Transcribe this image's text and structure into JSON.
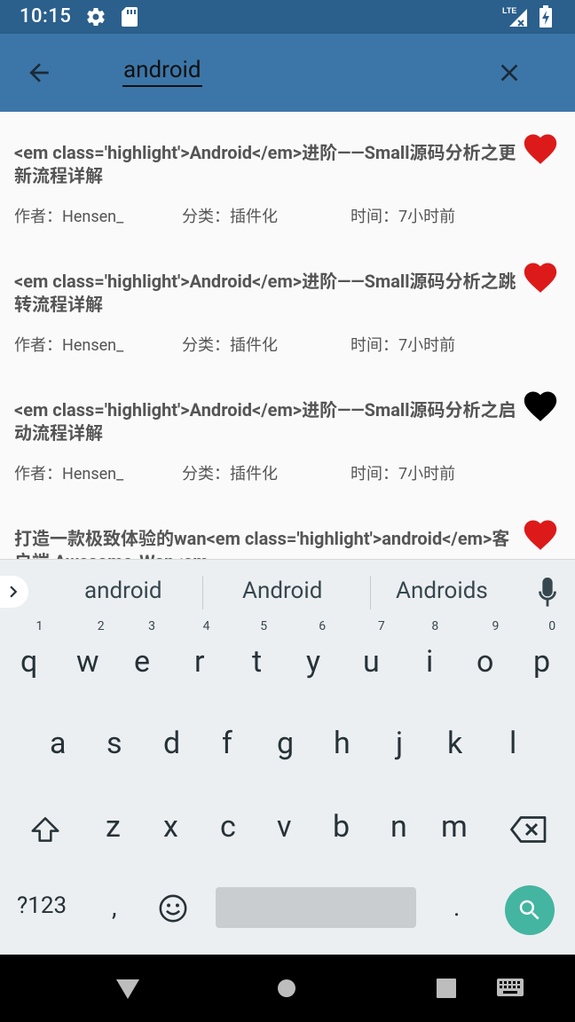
{
  "status_bar": {
    "time": "10:15",
    "network": "LTE"
  },
  "app_bar": {
    "search_query": "android"
  },
  "results": [
    {
      "title": "<em class='highlight'>Android</em>进阶——Small源码分析之更新流程详解",
      "author": "作者：Hensen_",
      "category": "分类：插件化",
      "time": "时间：7小时前",
      "favorited": true
    },
    {
      "title": " <em class='highlight'>Android</em>进阶——Small源码分析之跳转流程详解",
      "author": "作者：Hensen_",
      "category": "分类：插件化",
      "time": "时间：7小时前",
      "favorited": true
    },
    {
      "title": " <em class='highlight'>Android</em>进阶——Small源码分析之启动流程详解",
      "author": "作者：Hensen_",
      "category": "分类：插件化",
      "time": "时间：7小时前",
      "favorited": false
    },
    {
      "title": "打造一款极致体验的wan<em class='highlight'>android</em>客户端 Awesome-Wan<em",
      "author": "",
      "category": "",
      "time": "",
      "favorited": true
    }
  ],
  "suggestions": [
    "android",
    "Android",
    "Androids"
  ],
  "keyboard": {
    "row1": [
      {
        "key": "q",
        "hint": "1"
      },
      {
        "key": "w",
        "hint": "2"
      },
      {
        "key": "e",
        "hint": "3"
      },
      {
        "key": "r",
        "hint": "4"
      },
      {
        "key": "t",
        "hint": "5"
      },
      {
        "key": "y",
        "hint": "6"
      },
      {
        "key": "u",
        "hint": "7"
      },
      {
        "key": "i",
        "hint": "8"
      },
      {
        "key": "o",
        "hint": "9"
      },
      {
        "key": "p",
        "hint": "0"
      }
    ],
    "row2": [
      "a",
      "s",
      "d",
      "f",
      "g",
      "h",
      "j",
      "k",
      "l"
    ],
    "row3": [
      "z",
      "x",
      "c",
      "v",
      "b",
      "n",
      "m"
    ],
    "symbols_label": "?123",
    "comma": ",",
    "period": "."
  },
  "colors": {
    "status_bar": "#2b5f8c",
    "app_bar": "#3c76a8",
    "heart_favorited": "#dd1a1a",
    "heart_unfavorited": "#000000",
    "search_key": "#43b5a0"
  }
}
